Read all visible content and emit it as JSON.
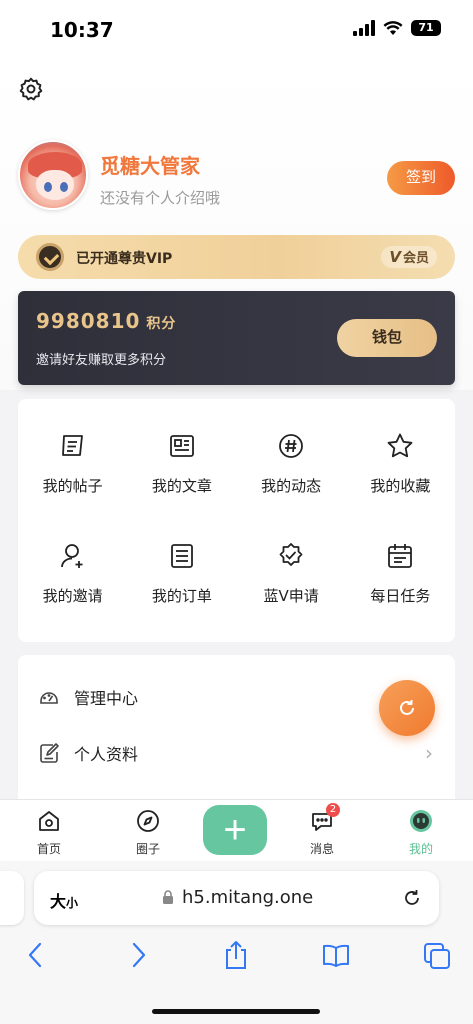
{
  "status_bar": {
    "time": "10:37",
    "battery": "71"
  },
  "profile": {
    "username": "觅糖大管家",
    "intro": "还没有个人介绍哦",
    "checkin_label": "签到"
  },
  "vip": {
    "text": "已开通尊贵VIP",
    "tag_letter": "V",
    "tag_label": "会员"
  },
  "points": {
    "value": "9980810",
    "unit": "积分",
    "hint": "邀请好友赚取更多积分",
    "wallet_label": "钱包"
  },
  "grid": [
    {
      "label": "我的帖子",
      "icon": "post-icon"
    },
    {
      "label": "我的文章",
      "icon": "article-icon"
    },
    {
      "label": "我的动态",
      "icon": "hashtag-icon"
    },
    {
      "label": "我的收藏",
      "icon": "star-icon"
    },
    {
      "label": "我的邀请",
      "icon": "invite-user-icon"
    },
    {
      "label": "我的订单",
      "icon": "order-icon"
    },
    {
      "label": "蓝V申请",
      "icon": "verified-badge-icon"
    },
    {
      "label": "每日任务",
      "icon": "calendar-icon"
    }
  ],
  "list": [
    {
      "label": "管理中心",
      "icon": "dashboard-icon"
    },
    {
      "label": "个人资料",
      "icon": "edit-icon"
    }
  ],
  "tabbar": {
    "items": [
      {
        "label": "首页",
        "icon": "home-icon"
      },
      {
        "label": "圈子",
        "icon": "compass-icon"
      },
      {
        "label": "消息",
        "icon": "message-icon",
        "badge": "2"
      },
      {
        "label": "我的",
        "icon": "profile-face-icon",
        "active": true
      }
    ],
    "plus_label": "+"
  },
  "browser": {
    "text_size": "大",
    "text_size_small": "小",
    "url": "h5.mitang.one"
  },
  "colors": {
    "accent": "#f0783c",
    "green": "#66c6a0",
    "gold": "#e9c48b"
  }
}
